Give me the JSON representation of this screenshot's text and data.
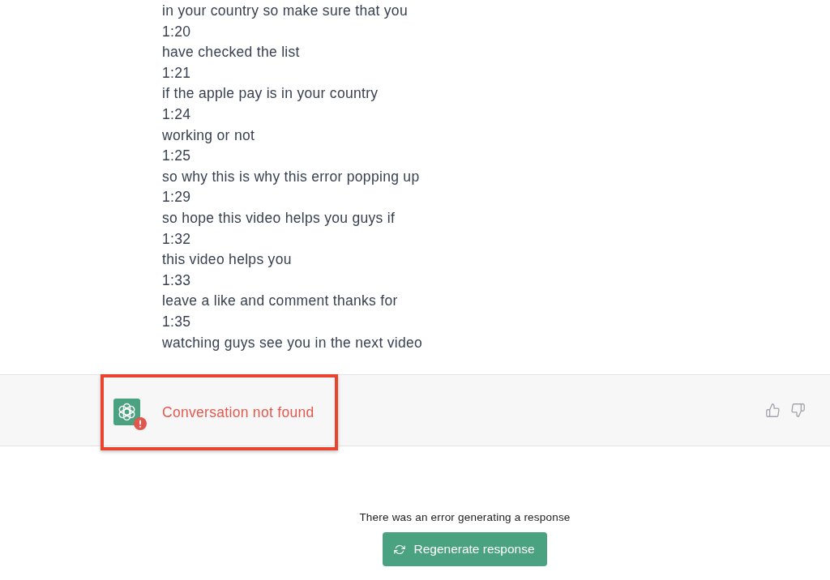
{
  "transcript": [
    {
      "text": "in your country so make sure that you"
    },
    {
      "time": "1:20",
      "text": "have checked the list"
    },
    {
      "time": "1:21",
      "text": "if the apple pay is in your country"
    },
    {
      "time": "1:24",
      "text": "working or not"
    },
    {
      "time": "1:25",
      "text": "so why this is why this error popping up"
    },
    {
      "time": "1:29",
      "text": "so hope this video helps you guys if"
    },
    {
      "time": "1:32",
      "text": "this video helps you"
    },
    {
      "time": "1:33",
      "text": "leave a like and comment thanks for"
    },
    {
      "time": "1:35",
      "text": "watching guys see you in the next video"
    }
  ],
  "error_message": {
    "text": "Conversation not found",
    "highlighted": true
  },
  "error_notice": "There was an error generating a response",
  "regenerate_button": {
    "label": "Regenerate response"
  }
}
